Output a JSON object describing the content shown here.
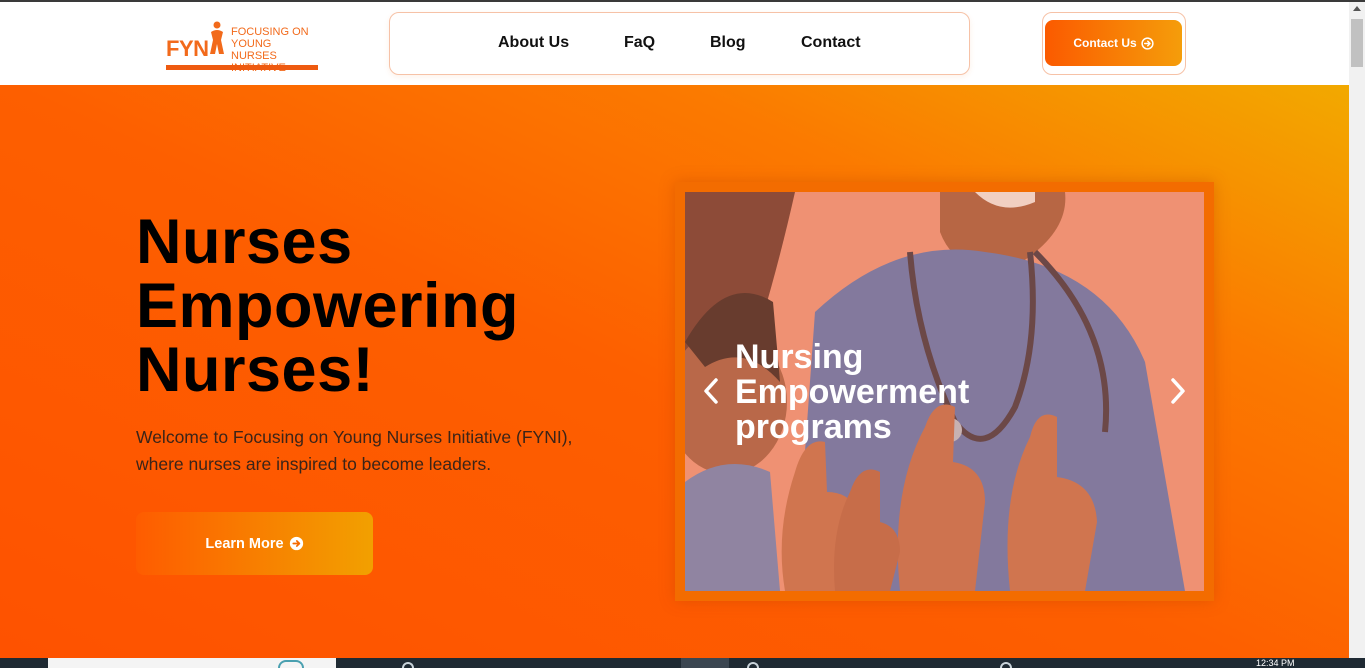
{
  "header": {
    "logo": {
      "abbr": "FYN",
      "line1": "Focusing on",
      "line2": "Young Nurses",
      "line3": "Initiative",
      "icon": "nurse-figure-icon"
    },
    "nav": [
      {
        "label": "About Us"
      },
      {
        "label": "FaQ"
      },
      {
        "label": "Blog"
      },
      {
        "label": "Contact"
      }
    ],
    "cta": {
      "label": "Contact Us",
      "icon": "arrow-circle-right-icon"
    }
  },
  "hero": {
    "headline": [
      "Nurses",
      "Empowering",
      "Nurses!"
    ],
    "subtext": "Welcome to Focusing on Young Nurses Initiative (FYNI), where nurses are inspired to become leaders.",
    "button": {
      "label": "Learn More",
      "icon": "arrow-circle-right-icon"
    }
  },
  "slider": {
    "caption": [
      "Nursing",
      "Empowerment",
      "programs"
    ],
    "prev_icon": "chevron-left-icon",
    "next_icon": "chevron-right-icon"
  },
  "taskbar": {
    "time": "12:34 PM"
  },
  "colors": {
    "brand_orange": "#f26a1b",
    "gradient_start": "#fe5200",
    "gradient_end": "#f2a900"
  }
}
